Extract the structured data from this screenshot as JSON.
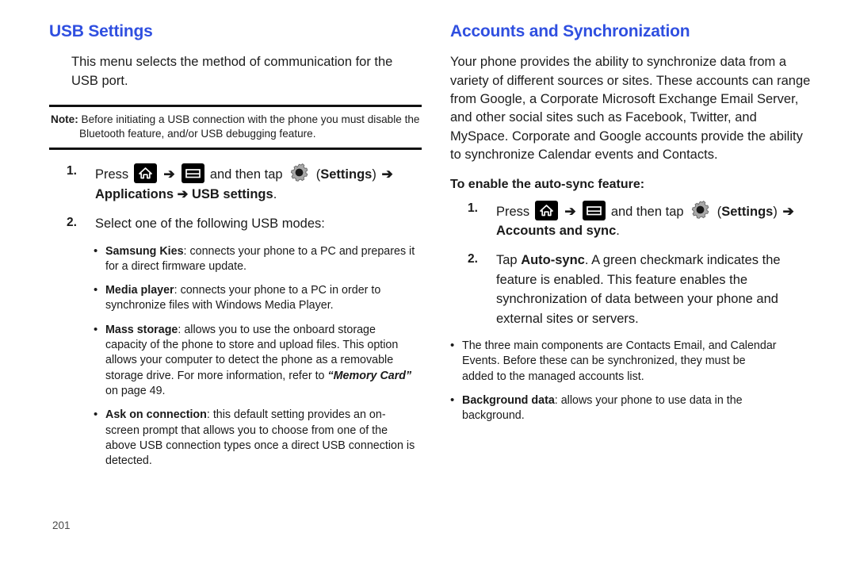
{
  "page": {
    "number": "201",
    "heading_color": "#2f4fe0"
  },
  "left_column": {
    "heading": "USB Settings",
    "intro": "This menu selects the method of communication for the USB port.",
    "note": {
      "label": "Note:",
      "line1": "Before initiating a USB connection with the phone you must disable the",
      "line2": "Bluetooth feature, and/or USB debugging feature."
    },
    "steps": [
      {
        "number": "1.",
        "pre_icon_text": "Press",
        "icon_home": "home-icon",
        "arrow": "➔",
        "icon_menu": "menu-icon",
        "mid_text": "and then tap",
        "icon_gear": "gear-icon",
        "settings_open": "(",
        "settings_label": "Settings",
        "settings_close": ")",
        "trailing_arrow": "➔",
        "line2_bold": "Applications ➔ USB settings",
        "line2_period": "."
      },
      {
        "number": "2.",
        "text": "Select one of the following USB modes:"
      }
    ],
    "usb_modes": [
      {
        "term": "Samsung Kies",
        "desc": ": connects your phone to a PC and prepares it for a direct firmware update."
      },
      {
        "term": "Media player",
        "desc": ": connects your phone to a PC in order to synchronize files with Windows Media Player."
      },
      {
        "term": "Mass storage",
        "desc_before": ": allows you to use the onboard storage capacity of the phone to store and upload files. This option allows your computer to detect the phone as a removable storage drive. For more information, refer to ",
        "reference": "“Memory Card”",
        "desc_after": " on page 49."
      },
      {
        "term": "Ask on connection",
        "desc": ": this default setting provides an on-screen prompt that allows you to choose from one of the above USB connection types once a direct USB connection is detected."
      }
    ]
  },
  "right_column": {
    "heading": "Accounts and Synchronization",
    "intro": "Your phone provides the ability to synchronize data from a variety of different sources or sites. These accounts can range from Google, a Corporate Microsoft Exchange Email Server, and other social sites such as Facebook, Twitter, and MySpace. Corporate and Google accounts provide the ability to synchronize Calendar events and Contacts.",
    "subhead": "To enable the auto-sync feature:",
    "steps": [
      {
        "number": "1.",
        "pre_icon_text": "Press",
        "icon_home": "home-icon",
        "arrow": "➔",
        "icon_menu": "menu-icon",
        "mid_text": "and then tap",
        "icon_gear": "gear-icon",
        "settings_open": "(",
        "settings_label": "Settings",
        "settings_close": ")",
        "trailing_arrow": "➔",
        "line2_bold": "Accounts and sync",
        "line2_period": "."
      },
      {
        "number": "2.",
        "text_before": "Tap ",
        "bold_term": "Auto-sync",
        "text_after": ". A green checkmark indicates the feature is enabled. This feature enables the synchronization of data between your phone and external sites or servers."
      }
    ],
    "sub_bullets": [
      {
        "desc": "The three main components are Contacts Email, and Calendar Events. Before these can be synchronized, they must be added to the managed accounts list."
      },
      {
        "term": "Background data",
        "desc": ": allows your phone to use data in the background."
      }
    ]
  }
}
